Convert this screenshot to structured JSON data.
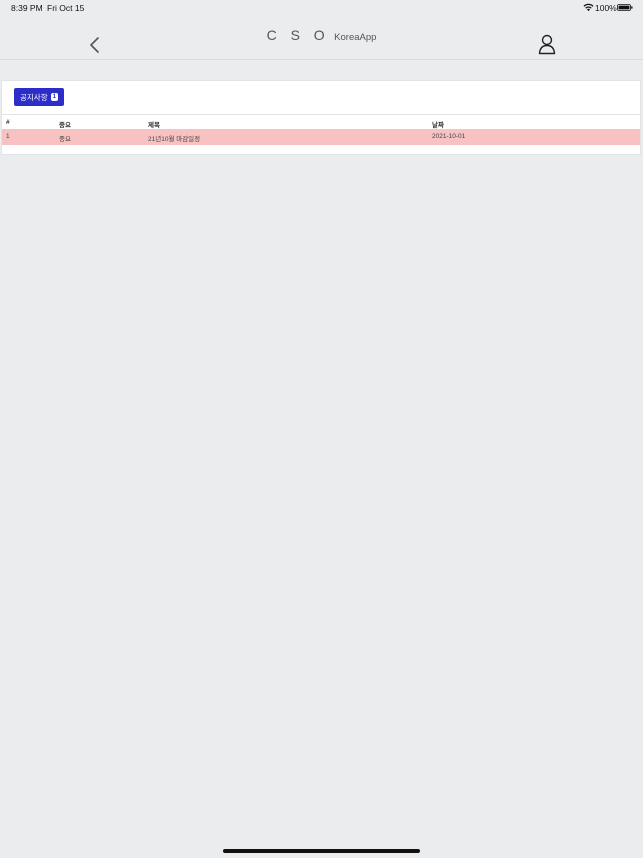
{
  "status": {
    "time": "8:39 PM",
    "date": "Fri Oct 15",
    "battery": "100%"
  },
  "nav": {
    "brand": "C S O",
    "subtitle": "KoreaApp"
  },
  "notice": {
    "label": "공지사항",
    "count": "1"
  },
  "table": {
    "headers": [
      "#",
      "중요",
      "제목",
      "날짜"
    ],
    "rows": [
      {
        "num": "1",
        "importance": "중요",
        "title": "21년10월 마감일정",
        "date": "2021-10-01"
      }
    ]
  },
  "colors": {
    "accent": "#2d2ec9",
    "row_highlight": "#f9c2c2",
    "background": "#ebecee"
  }
}
